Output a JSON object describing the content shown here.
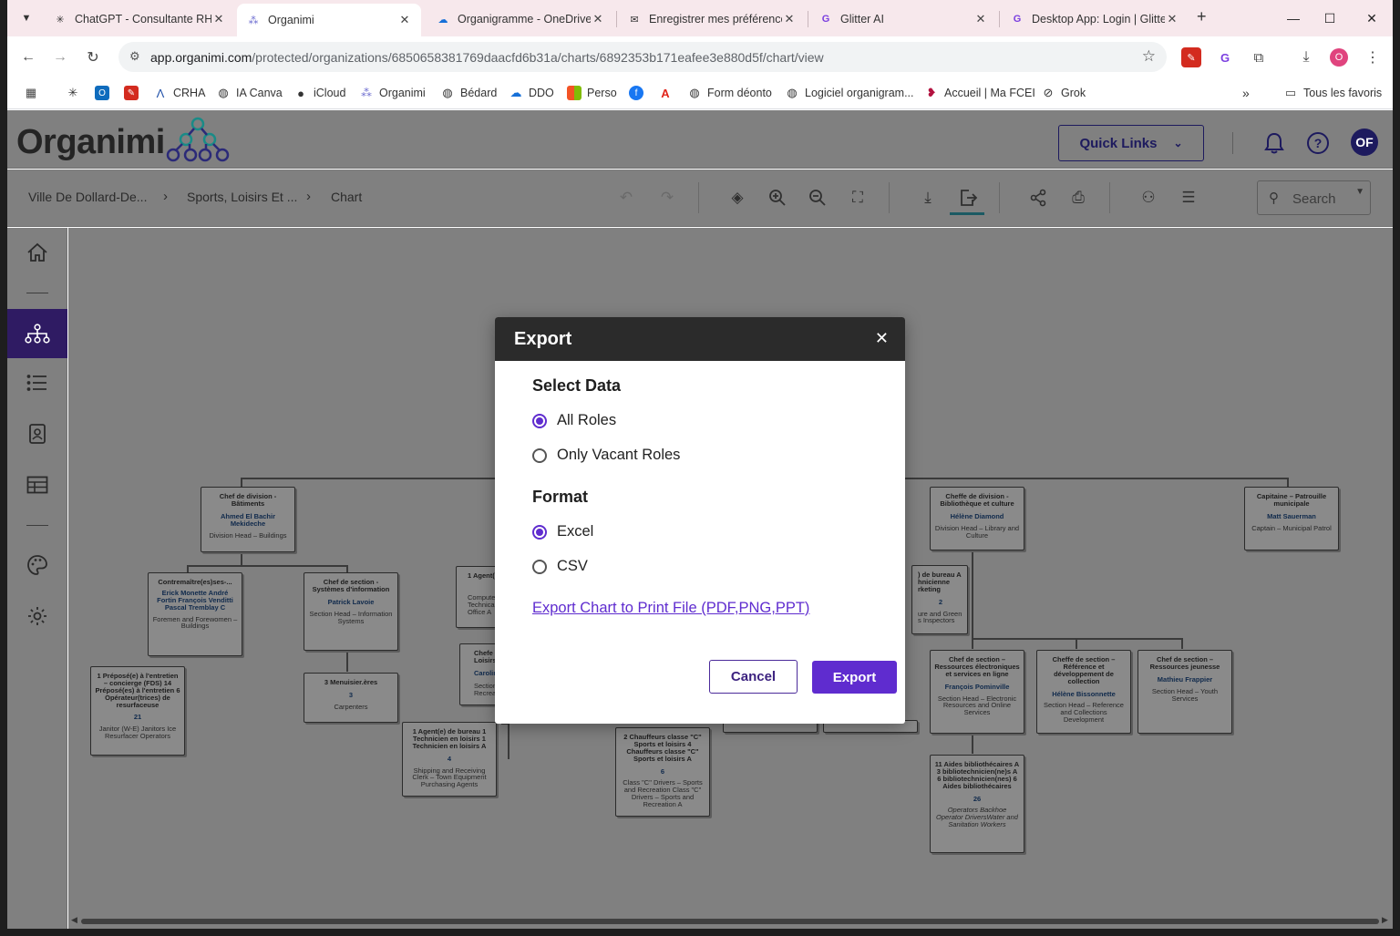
{
  "browser": {
    "tabs": [
      {
        "label": "ChatGPT - Consultante RH",
        "icon": "chatgpt-icon",
        "active": false
      },
      {
        "label": "Organimi",
        "icon": "organimi-icon",
        "active": true
      },
      {
        "label": "Organigramme - OneDrive",
        "icon": "onedrive-icon",
        "active": false
      },
      {
        "label": "Enregistrer mes préférences",
        "icon": "mail-icon",
        "active": false
      },
      {
        "label": "Glitter AI",
        "icon": "glitter-icon",
        "active": false
      },
      {
        "label": "Desktop App: Login | Glitter",
        "icon": "glitter-icon",
        "active": false
      }
    ],
    "url_host": "app.organimi.com",
    "url_path": "/protected/organizations/6850658381769daacfd6b31a/charts/6892353b171eafee3e880d5f/chart/view",
    "profile_initial": "O",
    "bookmarks": [
      {
        "label": "",
        "icon": "openai-icon"
      },
      {
        "label": "",
        "icon": "outlook-icon"
      },
      {
        "label": "",
        "icon": "pdf-icon"
      },
      {
        "label": "CRHA",
        "icon": "crha-icon"
      },
      {
        "label": "IA Canva",
        "icon": "globe-icon"
      },
      {
        "label": "iCloud",
        "icon": "apple-icon"
      },
      {
        "label": "Organimi",
        "icon": "organimi-icon"
      },
      {
        "label": "Bédard",
        "icon": "globe-icon"
      },
      {
        "label": "DDO",
        "icon": "onedrive-icon"
      },
      {
        "label": "Perso",
        "icon": "microsoft-icon"
      },
      {
        "label": "",
        "icon": "facebook-icon"
      },
      {
        "label": "",
        "icon": "adobe-icon"
      },
      {
        "label": "Form déonto",
        "icon": "globe-icon"
      },
      {
        "label": "Logiciel organigram...",
        "icon": "globe-icon"
      },
      {
        "label": "Accueil | Ma FCEI",
        "icon": "fcei-icon"
      },
      {
        "label": "Grok",
        "icon": "grok-icon"
      }
    ],
    "all_bookmarks": "Tous les favoris"
  },
  "app": {
    "logo": "Organimi",
    "quick_links": "Quick Links",
    "avatar": "OF",
    "breadcrumb": [
      "Ville De Dollard-De...",
      "Sports, Loisirs Et ...",
      "Chart"
    ],
    "search_placeholder": "Search"
  },
  "chart_nodes": [
    {
      "title": "Chef de division - Bâtiments",
      "name": "Ahmed El Bachir Mekideche",
      "desc": "Division Head – Buildings"
    },
    {
      "title": "Contremaître(es)ses-...",
      "name": "Erick Monette André Fortin François Venditti Pascal Tremblay C",
      "desc": "Foremen and Forewomen – Buildings"
    },
    {
      "title": "Chef de section - Systèmes d'information",
      "name": "Patrick Lavoie",
      "desc": "Section Head – Information Systems"
    },
    {
      "title": "1 Préposé(e) à l'entretien – concierge (FDS) 14 Préposé(es) à l'entretien 6 Opérateur(trices) de resurfaceuse",
      "name": "21",
      "desc": "Janitor (W-E) Janitors Ice Resurfacer Operators"
    },
    {
      "title": "3 Menuisier.ères",
      "name": "3",
      "desc": "Carpenters"
    },
    {
      "title": "1 Agent(e)",
      "name": "",
      "desc": "Computer Technical Office A"
    },
    {
      "title": "Chefe de Loisirs",
      "name": "Carolin",
      "desc": "Section Recreatio"
    },
    {
      "title": "1 Agent(e) de bureau 1 Technicien en loisirs 1 Technicien en loisirs A",
      "name": "4",
      "desc": "Shipping and Receiving Clerk – Town Equipment Purchasing Agents"
    },
    {
      "title": "2 Chauffeurs classe \"C\" Sports et loisirs 4 Chauffeurs classe \"C\" Sports et loisirs A",
      "name": "6",
      "desc": "Class \"C\" Drivers – Sports and Recreation Class \"C\" Drivers – Sports and Recreation A"
    },
    {
      "title": "Cheffe de division - Bibliothèque et culture",
      "name": "Hélène Diamond",
      "desc": "Division Head – Library and Culture"
    },
    {
      "title": ") de bureau A hnicienne rketing",
      "name": "2",
      "desc": "ure and Green s Inspectors"
    },
    {
      "title": "Chef de section – Ressources électroniques et services en ligne",
      "name": "François Pominville",
      "desc": "Section Head – Electronic Resources and Online Services"
    },
    {
      "title": "Cheffe de section – Référence et développement de collection",
      "name": "Hélène Bissonnette",
      "desc": "Section Head – Reference and Collections Development"
    },
    {
      "title": "Chef de section – Ressources jeunesse",
      "name": "Mathieu Frappier",
      "desc": "Section Head – Youth Services"
    },
    {
      "title": "11 Aides bibliothécaires A 3 bibliotechnicien(ne)s A 6 bibliotechnicien(nes) 6 Aides bibliothécaires",
      "name": "26",
      "desc": "Operators Backhoe Operator DriversWater and Sanitation Workers"
    },
    {
      "title": "Capitaine – Patrouille municipale",
      "name": "Matt Sauerman",
      "desc": "Captain – Municipal Patrol"
    }
  ],
  "modal": {
    "title": "Export",
    "select_data_heading": "Select Data",
    "data_options": [
      {
        "label": "All Roles",
        "checked": true
      },
      {
        "label": "Only Vacant Roles",
        "checked": false
      }
    ],
    "format_heading": "Format",
    "format_options": [
      {
        "label": "Excel",
        "checked": true
      },
      {
        "label": "CSV",
        "checked": false
      }
    ],
    "print_link": "Export Chart to Print File (PDF,PNG,PPT)",
    "cancel": "Cancel",
    "export": "Export"
  },
  "colors": {
    "accent": "#5f2ccf",
    "navy": "#1d1a5e",
    "sidebar_active": "#2f1b63",
    "modal_header": "#2b2b2b"
  }
}
